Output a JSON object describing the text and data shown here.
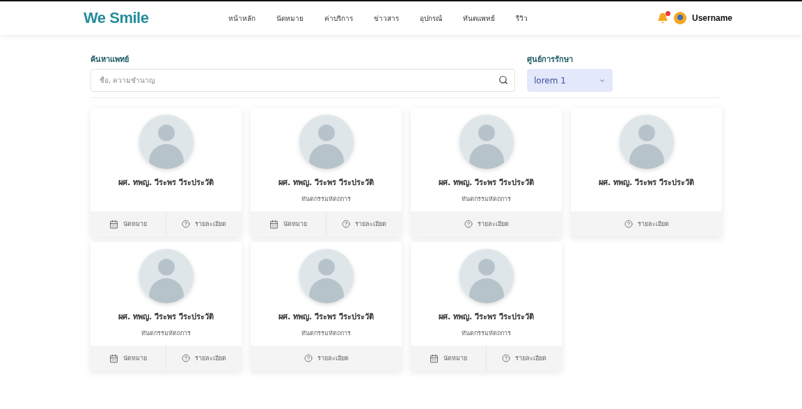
{
  "header": {
    "logo": "We Smile",
    "nav": [
      {
        "label": "หน้าหลัก"
      },
      {
        "label": "นัดหมาย"
      },
      {
        "label": "ค่าบริการ"
      },
      {
        "label": "ข่าวสาร"
      },
      {
        "label": "อุปกรณ์"
      },
      {
        "label": "ทันตแพทย์"
      },
      {
        "label": "รีวิว"
      }
    ],
    "notification_dot": true,
    "username": "Username"
  },
  "search": {
    "label": "ค้นหาแพทย์",
    "placeholder": "ชื่อ, ความชำนาญ"
  },
  "center": {
    "label": "ศูนย์การรักษา",
    "value": "lorem 1"
  },
  "doctors": [
    {
      "name": "ผศ. ทพญ. วีระพร วีระประวัติ",
      "actions": [
        {
          "kind": "appointment",
          "label": "นัดหมาย"
        },
        {
          "kind": "details",
          "label": "รายละเอียด"
        }
      ]
    },
    {
      "name": "ผศ. ทพญ. วีระพร วีระประวัติ",
      "specialty": "ทันตกรรมหัตถการ",
      "actions": [
        {
          "kind": "appointment",
          "label": "นัดหมาย"
        },
        {
          "kind": "details",
          "label": "รายละเอียด"
        }
      ]
    },
    {
      "name": "ผศ. ทพญ. วีระพร วีระประวัติ",
      "specialty": "ทันตกรรมหัตถการ",
      "actions": [
        {
          "kind": "details",
          "label": "รายละเอียด"
        }
      ]
    },
    {
      "name": "ผศ. ทพญ. วีระพร วีระประวัติ",
      "actions": [
        {
          "kind": "details",
          "label": "รายละเอียด"
        }
      ]
    },
    {
      "name": "ผศ. ทพญ. วีระพร วีระประวัติ",
      "specialty": "ทันตกรรมหัตถการ",
      "actions": [
        {
          "kind": "appointment",
          "label": "นัดหมาย"
        },
        {
          "kind": "details",
          "label": "รายละเอียด"
        }
      ]
    },
    {
      "name": "ผศ. ทพญ. วีระพร วีระประวัติ",
      "specialty": "ทันตกรรมหัตถการ",
      "actions": [
        {
          "kind": "details",
          "label": "รายละเอียด"
        }
      ]
    },
    {
      "name": "ผศ. ทพญ. วีระพร วีระประวัติ",
      "specialty": "ทันตกรรมหัตถการ",
      "actions": [
        {
          "kind": "appointment",
          "label": "นัดหมาย"
        },
        {
          "kind": "details",
          "label": "รายละเอียด"
        }
      ]
    }
  ]
}
